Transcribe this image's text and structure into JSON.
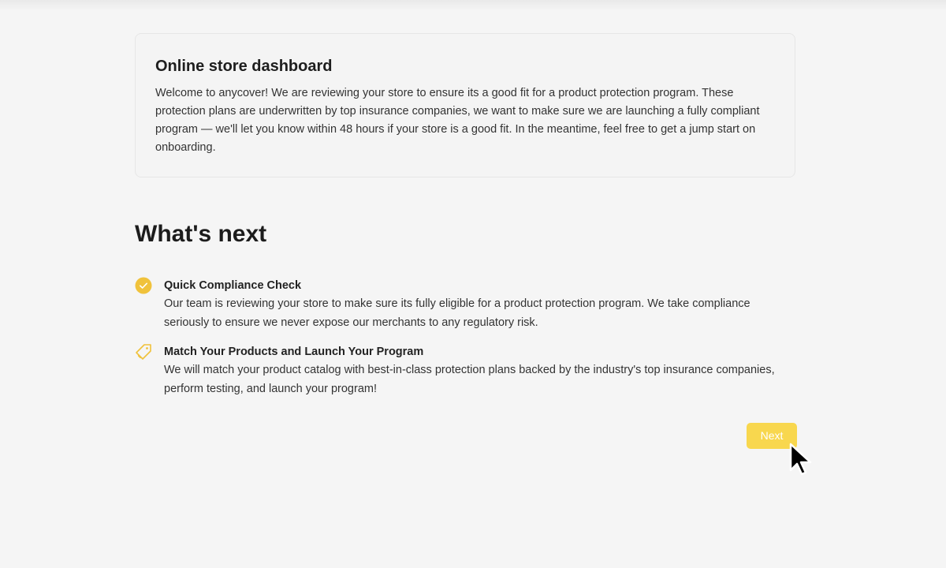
{
  "dashboard": {
    "title": "Online store dashboard",
    "welcome_text": "Welcome to anycover! We are reviewing your store to ensure its a good fit for a product protection program. These protection plans are underwritten by top insurance companies, we want to make sure we are launching a fully compliant program — we'll let you know within 48 hours if your store is a good fit. In the meantime, feel free to get a jump start on onboarding."
  },
  "whats_next": {
    "title": "What's next",
    "steps": [
      {
        "icon": "check-circle-icon",
        "title": "Quick Compliance Check",
        "description": "Our team is reviewing your store to make sure its fully eligible for a product protection program. We take compliance seriously to ensure we never expose our merchants to any regulatory risk."
      },
      {
        "icon": "tag-icon",
        "title": "Match Your Products and Launch Your Program",
        "description": "We will match your product catalog with best-in-class protection plans backed by the industry's top insurance companies, perform testing, and launch your program!"
      }
    ]
  },
  "actions": {
    "next_label": "Next"
  },
  "colors": {
    "accent": "#f8d74e",
    "icon_accent": "#f0c23b",
    "background": "#f5f5f5"
  }
}
